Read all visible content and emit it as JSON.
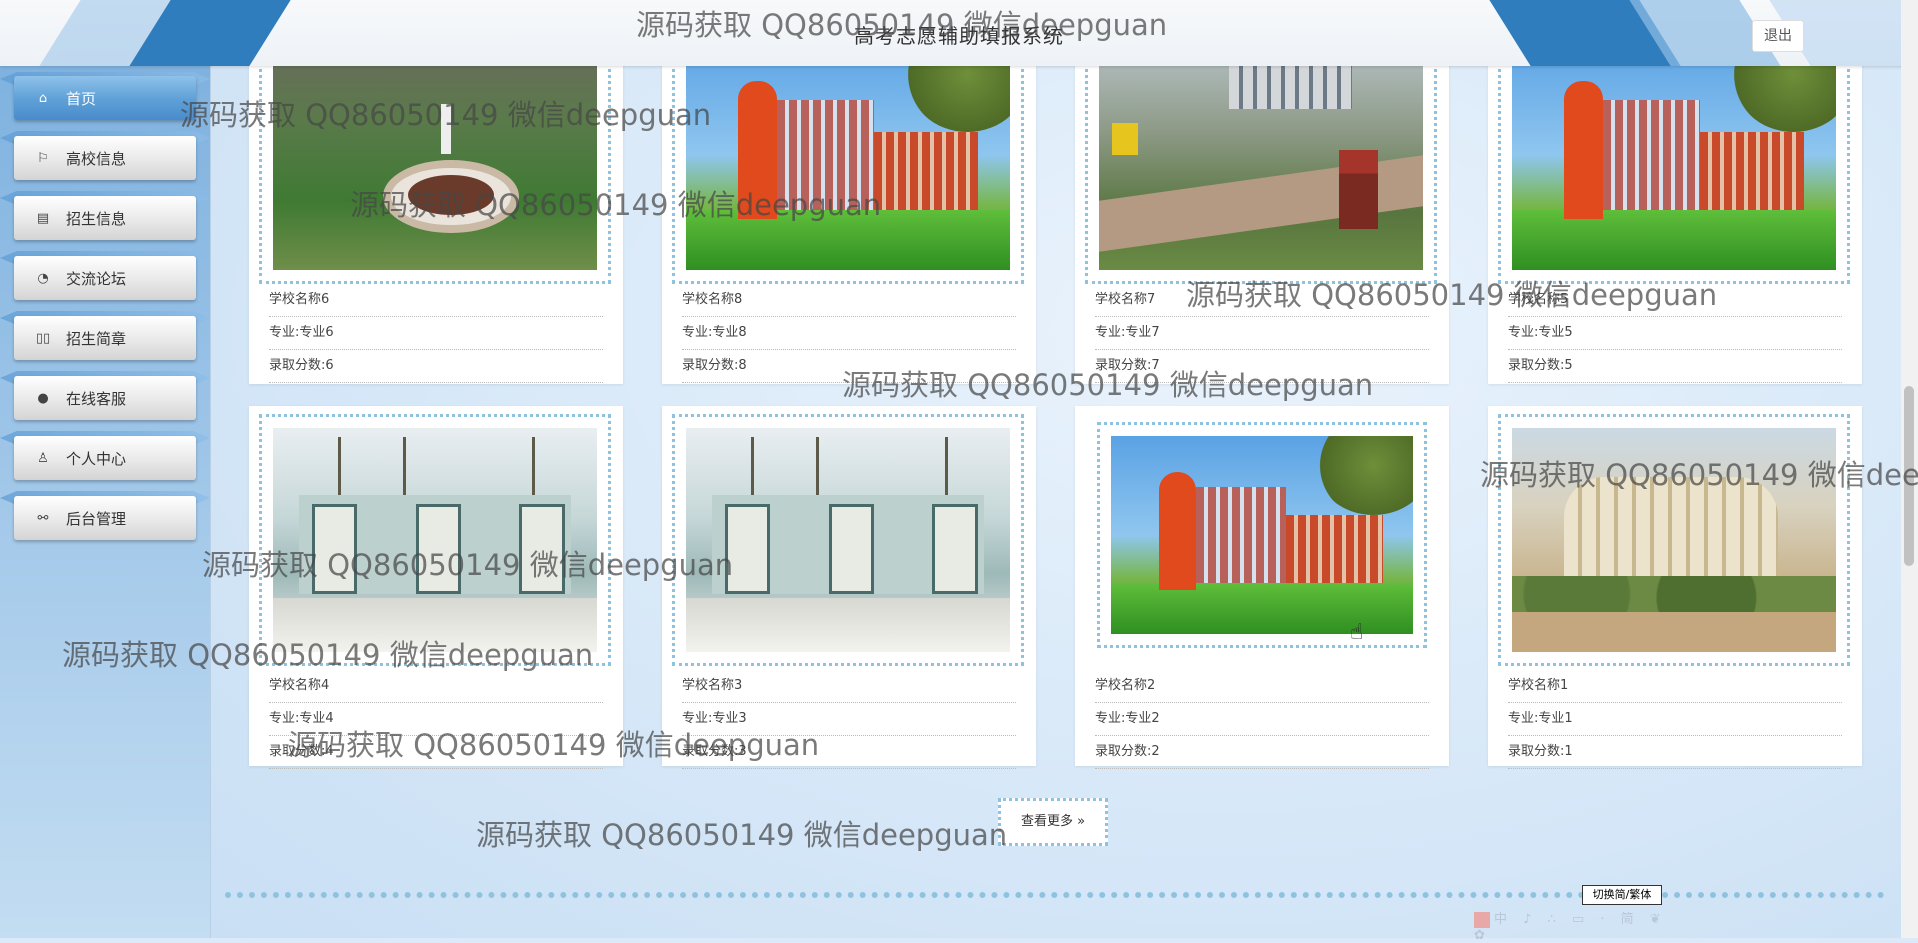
{
  "header": {
    "title": "高考志愿辅助填报系统",
    "logout_label": "退出"
  },
  "sidebar": {
    "items": [
      {
        "label": "首页",
        "icon": "home-icon",
        "glyph": "⌂"
      },
      {
        "label": "高校信息",
        "icon": "flag-icon",
        "glyph": "⚐"
      },
      {
        "label": "招生信息",
        "icon": "notepad-icon",
        "glyph": "▤"
      },
      {
        "label": "交流论坛",
        "icon": "palette-icon",
        "glyph": "◔"
      },
      {
        "label": "招生简章",
        "icon": "book-icon",
        "glyph": "▯▯"
      },
      {
        "label": "在线客服",
        "icon": "chat-icon",
        "glyph": "●"
      },
      {
        "label": "个人中心",
        "icon": "user-icon",
        "glyph": "♙"
      },
      {
        "label": "后台管理",
        "icon": "link-icon",
        "glyph": "⚯"
      }
    ]
  },
  "cards": [
    {
      "name": "学校名称6",
      "major": "专业:专业6",
      "score": "录取分数:6"
    },
    {
      "name": "学校名称8",
      "major": "专业:专业8",
      "score": "录取分数:8"
    },
    {
      "name": "学校名称7",
      "major": "专业:专业7",
      "score": "录取分数:7"
    },
    {
      "name": "学校名称5",
      "major": "专业:专业5",
      "score": "录取分数:5"
    },
    {
      "name": "学校名称4",
      "major": "专业:专业4",
      "score": "录取分数:4"
    },
    {
      "name": "学校名称3",
      "major": "专业:专业3",
      "score": "录取分数:3"
    },
    {
      "name": "学校名称2",
      "major": "专业:专业2",
      "score": "录取分数:2"
    },
    {
      "name": "学校名称1",
      "major": "专业:专业1",
      "score": "录取分数:1"
    }
  ],
  "load_more_label": "查看更多 »",
  "switch_lang_label": "切换简/繁体",
  "ime_bar_text": "中 ♪ ∴ ▭ · 简 ❦ ✿",
  "watermark": "源码获取 QQ86050149 微信deepguan",
  "colors": {
    "accent": "#2f7dbc",
    "dotted_border": "#8fc2df",
    "nav_active": "#5d9fd6"
  }
}
